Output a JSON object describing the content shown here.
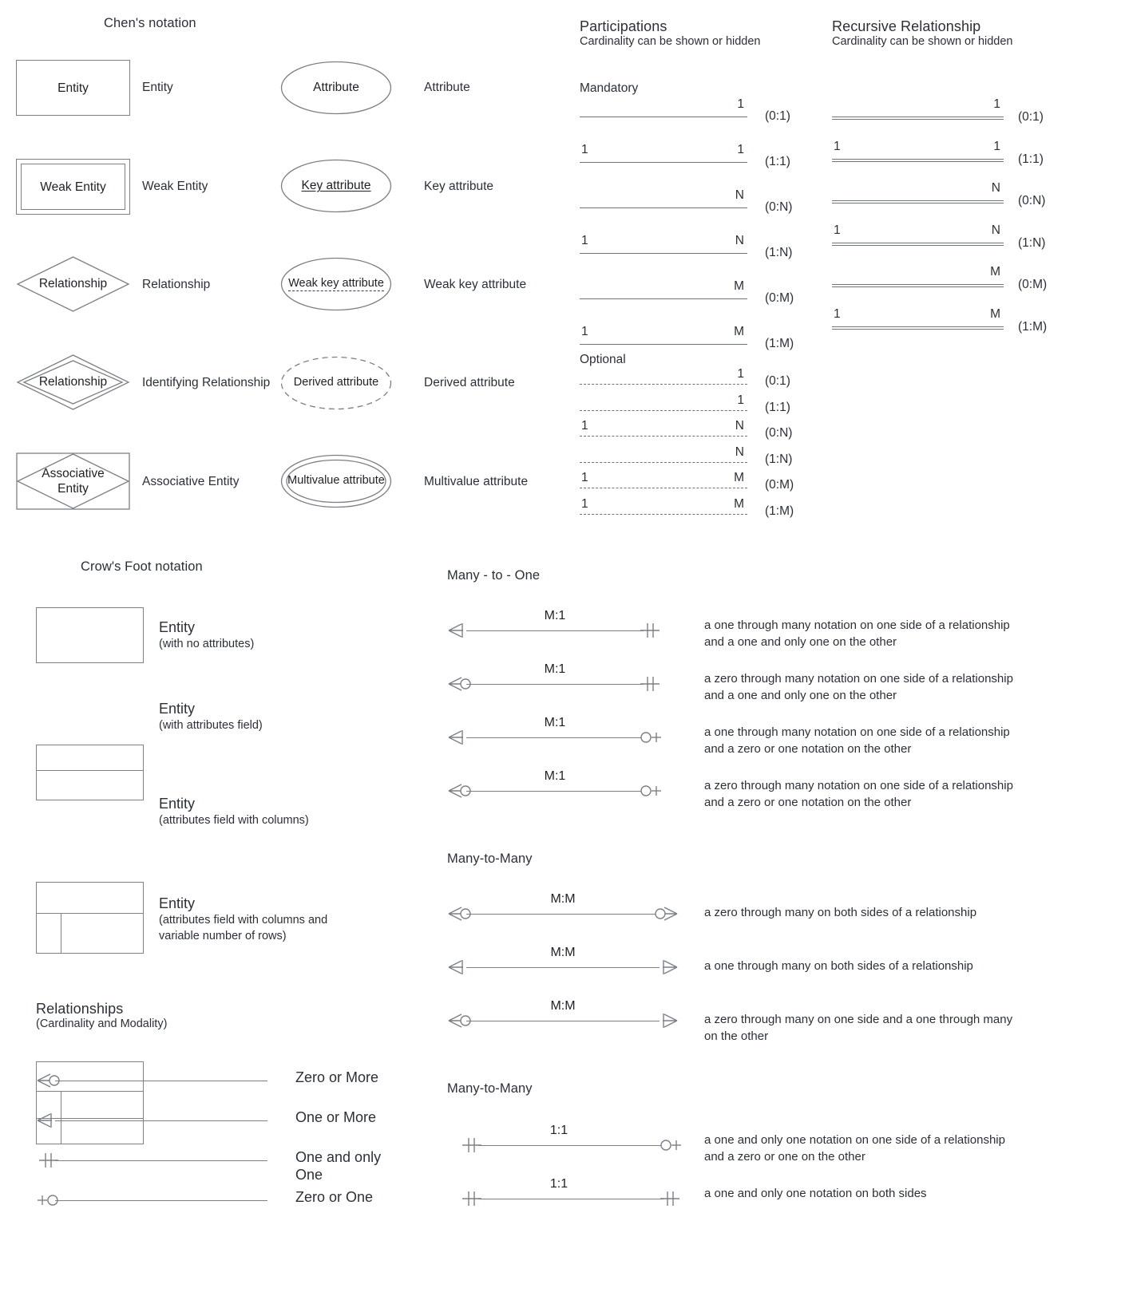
{
  "chen": {
    "title": "Chen's notation",
    "symbols": [
      {
        "shape_text": "Entity",
        "label": "Entity",
        "kind": "rect"
      },
      {
        "shape_text": "Weak Entity",
        "label": "Weak Entity",
        "kind": "double-rect"
      },
      {
        "shape_text": "Relationship",
        "label": "Relationship",
        "kind": "diamond"
      },
      {
        "shape_text": "Relationship",
        "label": "Identifying Relationship",
        "kind": "double-diamond"
      },
      {
        "shape_text": "Associative\nEntity",
        "label": "Associative Entity",
        "kind": "associative"
      }
    ],
    "attributes": [
      {
        "shape_text": "Attribute",
        "label": "Attribute",
        "kind": "ellipse"
      },
      {
        "shape_text": "Key attribute",
        "label": "Key attribute",
        "kind": "ellipse-underline"
      },
      {
        "shape_text": "Weak key attribute",
        "label": "Weak key attribute",
        "kind": "ellipse-dash-underline"
      },
      {
        "shape_text": "Derived attribute",
        "label": "Derived attribute",
        "kind": "ellipse-dashed"
      },
      {
        "shape_text": "Multivalue attribute",
        "label": "Multivalue attribute",
        "kind": "double-ellipse"
      }
    ]
  },
  "participations": {
    "title": "Participations",
    "subtitle": "Cardinality can be shown or hidden",
    "mandatory_label": "Mandatory",
    "optional_label": "Optional",
    "mandatory_rows": [
      {
        "left": "",
        "right": "1",
        "cardinality": "(0:1)"
      },
      {
        "left": "1",
        "right": "1",
        "cardinality": "(1:1)"
      },
      {
        "left": "",
        "right": "N",
        "cardinality": "(0:N)"
      },
      {
        "left": "1",
        "right": "N",
        "cardinality": "(1:N)"
      },
      {
        "left": "",
        "right": "M",
        "cardinality": "(0:M)"
      },
      {
        "left": "1",
        "right": "M",
        "cardinality": "(1:M)"
      }
    ],
    "optional_rows": [
      {
        "left": "",
        "right": "1",
        "cardinality": "(0:1)"
      },
      {
        "left": "",
        "right": "1",
        "cardinality": "(1:1)"
      },
      {
        "left": "1",
        "right": "N",
        "cardinality": "(0:N)"
      },
      {
        "left": "",
        "right": "N",
        "cardinality": "(1:N)"
      },
      {
        "left": "1",
        "right": "M",
        "cardinality": "(0:M)"
      },
      {
        "left": "1",
        "right": "M",
        "cardinality": "(1:M)"
      }
    ]
  },
  "recursive": {
    "title": "Recursive Relationship",
    "subtitle": "Cardinality can be shown or hidden",
    "rows": [
      {
        "left": "",
        "right": "1",
        "cardinality": "(0:1)"
      },
      {
        "left": "1",
        "right": "1",
        "cardinality": "(1:1)"
      },
      {
        "left": "",
        "right": "N",
        "cardinality": "(0:N)"
      },
      {
        "left": "1",
        "right": "N",
        "cardinality": "(1:N)"
      },
      {
        "left": "",
        "right": "M",
        "cardinality": "(0:M)"
      },
      {
        "left": "1",
        "right": "M",
        "cardinality": "(1:M)"
      }
    ]
  },
  "crowsfoot": {
    "title": "Crow's Foot notation",
    "entities": [
      {
        "name": "Entity",
        "detail": "(with no attributes)"
      },
      {
        "name": "Entity",
        "detail": "(with attributes field)"
      },
      {
        "name": "Entity",
        "detail": "(attributes field with columns)"
      },
      {
        "name": "Entity",
        "detail": "(attributes field with columns and\nvariable number of rows)"
      }
    ],
    "relationships_title": "Relationships",
    "relationships_subtitle": "(Cardinality and Modality)",
    "modality": [
      {
        "label": "Zero or More",
        "end": "zero-many"
      },
      {
        "label": "One or More",
        "end": "one-many"
      },
      {
        "label": "One and only\nOne",
        "end": "one-only"
      },
      {
        "label": "Zero or One",
        "end": "zero-one"
      }
    ]
  },
  "many_to_one": {
    "title": "Many - to - One",
    "rows": [
      {
        "cardinality": "M:1",
        "left_end": "one-many",
        "right_end": "one-only",
        "description": "a one through many notation on one side of a relationship\nand a one and only one on the other"
      },
      {
        "cardinality": "M:1",
        "left_end": "zero-many",
        "right_end": "one-only",
        "description": "a zero through many notation on one side of a relationship\nand a one and only one on the other"
      },
      {
        "cardinality": "M:1",
        "left_end": "one-many",
        "right_end": "zero-one",
        "description": "a one through many notation on one side of a relationship\nand a zero or one notation on the other"
      },
      {
        "cardinality": "M:1",
        "left_end": "zero-many",
        "right_end": "zero-one",
        "description": "a zero through many notation on one side of a relationship\nand a zero or one notation on the other"
      }
    ]
  },
  "many_to_many": {
    "title": "Many-to-Many",
    "rows": [
      {
        "cardinality": "M:M",
        "left_end": "zero-many",
        "right_end": "zero-many",
        "description": "a zero through many on both sides of a relationship"
      },
      {
        "cardinality": "M:M",
        "left_end": "one-many",
        "right_end": "one-many",
        "description": "a one through many on both sides of a relationship"
      },
      {
        "cardinality": "M:M",
        "left_end": "zero-many",
        "right_end": "one-many",
        "description": "a zero through many on one side and a one through many\non the other"
      }
    ]
  },
  "one_to_one": {
    "title": "Many-to-Many",
    "rows": [
      {
        "cardinality": "1:1",
        "left_end": "one-only",
        "right_end": "zero-one",
        "description": "a one and only one notation on one side of a relationship\nand a zero or one on the other"
      },
      {
        "cardinality": "1:1",
        "left_end": "one-only",
        "right_end": "one-only",
        "description": "a one and only one notation on both sides"
      }
    ]
  },
  "colors": {
    "stroke": "#7b7f86",
    "text": "#2b3038",
    "background": "#ffffff"
  }
}
